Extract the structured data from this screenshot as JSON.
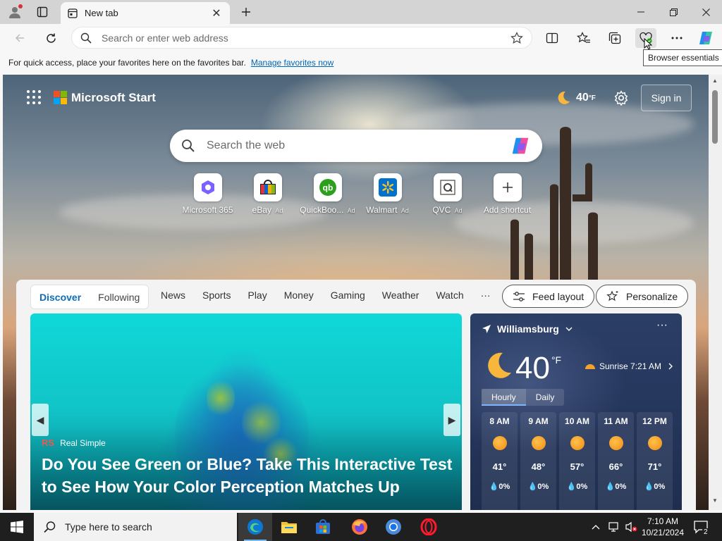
{
  "browser": {
    "tab_title": "New tab",
    "omnibox_placeholder": "Search or enter web address",
    "tooltip": "Browser essentials",
    "favorites_bar": {
      "message": "For quick access, place your favorites here on the favorites bar.",
      "link": "Manage favorites now"
    }
  },
  "page": {
    "brand": "Microsoft Start",
    "weather_temp": "40",
    "weather_unit": "°F",
    "sign_in": "Sign in",
    "search_placeholder": "Search the web",
    "shortcuts": [
      {
        "label": "Microsoft 365",
        "ad": ""
      },
      {
        "label": "eBay",
        "ad": "Ad"
      },
      {
        "label": "QuickBoo...",
        "ad": "Ad"
      },
      {
        "label": "Walmart",
        "ad": "Ad"
      },
      {
        "label": "QVC",
        "ad": "Ad"
      },
      {
        "label": "Add shortcut",
        "ad": ""
      }
    ]
  },
  "feed": {
    "pivots_primary": [
      "Discover",
      "Following"
    ],
    "pivots": [
      "News",
      "Sports",
      "Play",
      "Money",
      "Gaming",
      "Weather",
      "Watch"
    ],
    "more": "···",
    "feed_layout": "Feed layout",
    "personalize": "Personalize",
    "hero": {
      "source_badge": "RS",
      "source": "Real Simple",
      "headline": "Do You See Green or Blue? Take This Interactive Test to See How Your Color Perception Matches Up"
    }
  },
  "weather_card": {
    "location": "Williamsburg",
    "more": "···",
    "temp": "40",
    "unit": "°F",
    "sunrise": "Sunrise 7:21 AM",
    "tabs": [
      "Hourly",
      "Daily"
    ],
    "hours": [
      {
        "time": "8 AM",
        "temp": "41°",
        "rain": "0%"
      },
      {
        "time": "9 AM",
        "temp": "48°",
        "rain": "0%"
      },
      {
        "time": "10 AM",
        "temp": "57°",
        "rain": "0%"
      },
      {
        "time": "11 AM",
        "temp": "66°",
        "rain": "0%"
      },
      {
        "time": "12 PM",
        "temp": "71°",
        "rain": "0%"
      }
    ]
  },
  "taskbar": {
    "search_placeholder": "Type here to search",
    "time": "7:10 AM",
    "date": "10/21/2024",
    "notifications": "2"
  }
}
